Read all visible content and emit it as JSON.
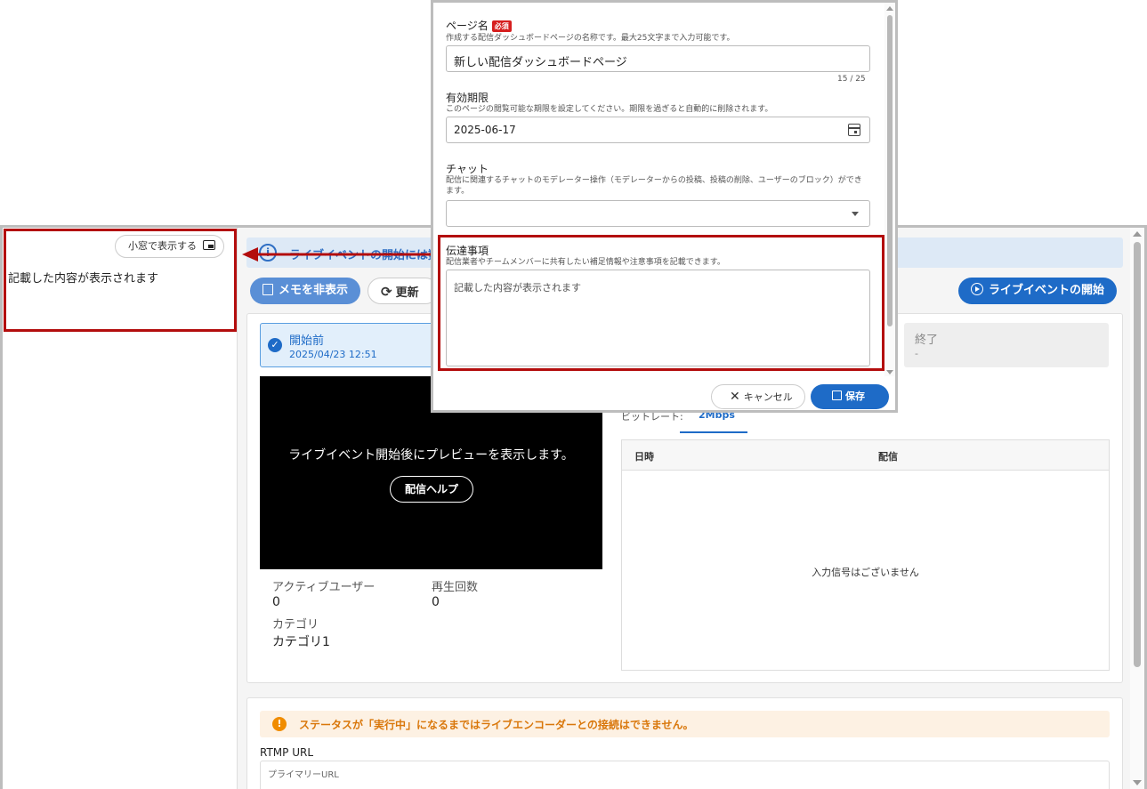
{
  "popout": {
    "button_label": "小窓で表示する",
    "memo_text": "記載した内容が表示されます"
  },
  "info_bar": {
    "text": "ライブイベントの開始には数"
  },
  "toolbar": {
    "hide_memo_label": "メモを非表示",
    "refresh_label": "更新",
    "start_live_label": "ライブイベントの開始"
  },
  "steps": [
    {
      "title": "開始前",
      "date": "2025/04/23 12:51"
    },
    {
      "title": "終了",
      "date": "-"
    }
  ],
  "preview": {
    "message": "ライブイベント開始後にプレビューを表示します。",
    "help_label": "配信ヘルプ"
  },
  "stats": {
    "active_users_label": "アクティブユーザー",
    "active_users_value": "0",
    "play_count_label": "再生回数",
    "play_count_value": "0",
    "category_label": "カテゴリ",
    "category_value": "カテゴリ1"
  },
  "bitrate": {
    "label": "ビットレート:",
    "tab": "2Mbps"
  },
  "signal_table": {
    "col_datetime": "日時",
    "col_stream": "配信",
    "empty_text": "入力信号はございません"
  },
  "warning": {
    "text": "ステータスが「実行中」になるまではライブエンコーダーとの接続はできません。"
  },
  "rtmp": {
    "title": "RTMP URL",
    "primary_label": "プライマリーURL"
  },
  "modal": {
    "page_name_label": "ページ名",
    "required_badge": "必須",
    "page_name_desc": "作成する配信ダッシュボードページの名称です。最大25文字まで入力可能です。",
    "page_name_value": "新しい配信ダッシュボードページ",
    "page_name_counter": "15 / 25",
    "expiry_label": "有効期限",
    "expiry_desc": "このページの閲覧可能な期限を設定してください。期限を過ぎると自動的に削除されます。",
    "expiry_value": "2025-06-17",
    "chat_label": "チャット",
    "chat_desc": "配信に関連するチャットのモデレーター操作（モデレーターからの投稿、投稿の削除、ユーザーのブロック）ができます。",
    "notes_label": "伝達事項",
    "notes_desc": "配信業者やチームメンバーに共有したい補足情報や注意事項を記載できます。",
    "notes_value": "記載した内容が表示されます",
    "cancel_label": "キャンセル",
    "save_label": "保存"
  }
}
